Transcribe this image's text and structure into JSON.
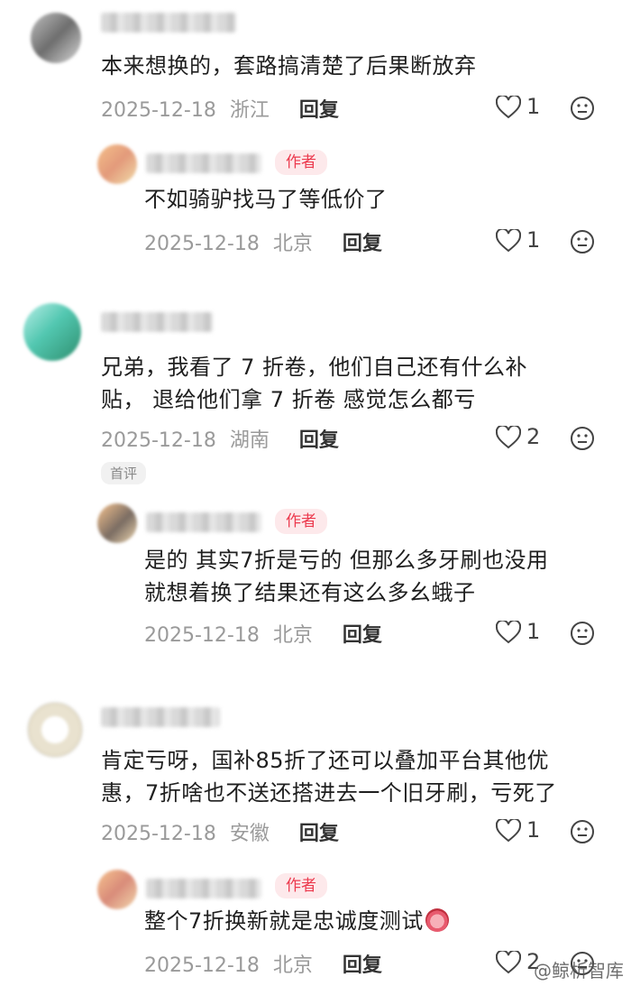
{
  "comments": [
    {
      "text_lines": [
        "本来想换的，套路搞清楚了后果断放弃"
      ],
      "date": "2025-12-18",
      "location": "浙江",
      "reply_label": "回复",
      "likes": "1",
      "reply": {
        "badge": "作者",
        "text_lines": [
          "不如骑驴找马了等低价了"
        ],
        "date": "2025-12-18",
        "location": "北京",
        "reply_label": "回复",
        "likes": "1"
      }
    },
    {
      "text_lines": [
        "兄弟，我看了 7 折卷，他们自己还有什么补",
        "贴， 退给他们拿 7 折卷 感觉怎么都亏"
      ],
      "date": "2025-12-18",
      "location": "湖南",
      "reply_label": "回复",
      "likes": "2",
      "first_badge": "首评",
      "reply": {
        "badge": "作者",
        "text_lines": [
          "是的 其实7折是亏的 但那么多牙刷也没用",
          "就想着换了结果还有这么多幺蛾子"
        ],
        "date": "2025-12-18",
        "location": "北京",
        "reply_label": "回复",
        "likes": "1"
      }
    },
    {
      "text_lines": [
        "肯定亏呀，国补85折了还可以叠加平台其他优",
        "惠，7折啥也不送还搭进去一个旧牙刷，亏死了"
      ],
      "date": "2025-12-18",
      "location": "安徽",
      "reply_label": "回复",
      "likes": "1",
      "reply": {
        "badge": "作者",
        "text_lines": [
          "整个7折换新就是忠诚度测试"
        ],
        "date": "2025-12-18",
        "location": "北京",
        "reply_label": "回复",
        "likes": "2"
      }
    }
  ],
  "watermark": "@鲸析智库",
  "icons": {
    "like": "heart-outline-icon",
    "dislike": "neutral-face-icon",
    "emoji": "crying-face-emoji"
  }
}
